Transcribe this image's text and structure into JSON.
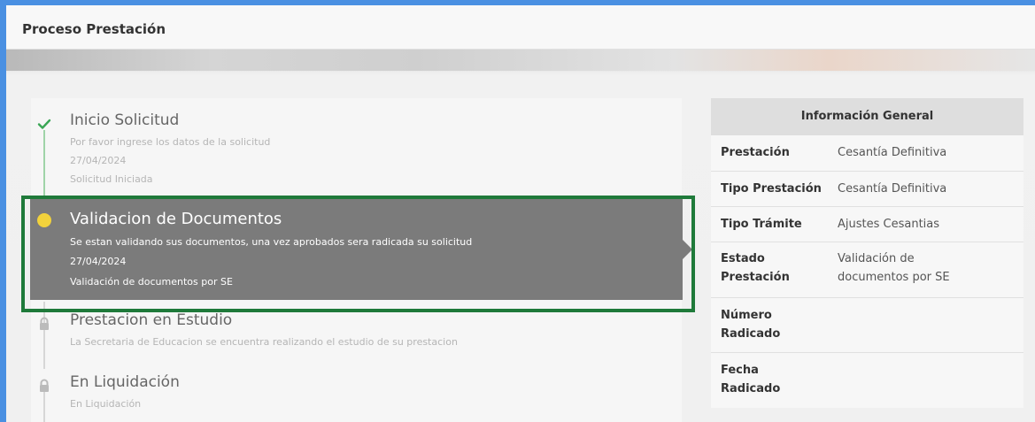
{
  "header": {
    "title": "Proceso Prestación"
  },
  "timeline": {
    "steps": [
      {
        "title": "Inicio Solicitud",
        "description": "Por favor ingrese los datos de la solicitud",
        "date": "27/04/2024",
        "status": "Solicitud Iniciada",
        "icon": "check-icon"
      },
      {
        "title": "Validacion de Documentos",
        "description": "Se estan validando sus documentos, una vez aprobados sera radicada su solicitud",
        "date": "27/04/2024",
        "status": "Validación de documentos por SE",
        "icon": "current-dot-icon"
      },
      {
        "title": "Prestacion en Estudio",
        "description": "La Secretaria de Educacion se encuentra realizando el estudio de su prestacion",
        "icon": "lock-icon"
      },
      {
        "title": "En Liquidación",
        "description": "En Liquidación",
        "icon": "lock-icon"
      }
    ]
  },
  "info": {
    "title": "Información General",
    "rows": [
      {
        "label": "Prestación",
        "value": "Cesantía Definitiva"
      },
      {
        "label": "Tipo Prestación",
        "value": "Cesantía Definitiva"
      },
      {
        "label": "Tipo Trámite",
        "value": "Ajustes Cesantias"
      },
      {
        "label_line1": "Estado",
        "label_line2": "Prestación",
        "value_line1": "Validación de",
        "value_line2": "documentos por SE"
      },
      {
        "label_line1": "Número",
        "label_line2": "Radicado",
        "value": ""
      },
      {
        "label_line1": "Fecha",
        "label_line2": "Radicado",
        "value": ""
      }
    ]
  },
  "colors": {
    "frame_blue": "#4a90e2",
    "check_green": "#3aa655",
    "current_yellow": "#f2d23c",
    "active_bg": "#7b7b7b",
    "highlight_green": "#1f7a3a"
  }
}
